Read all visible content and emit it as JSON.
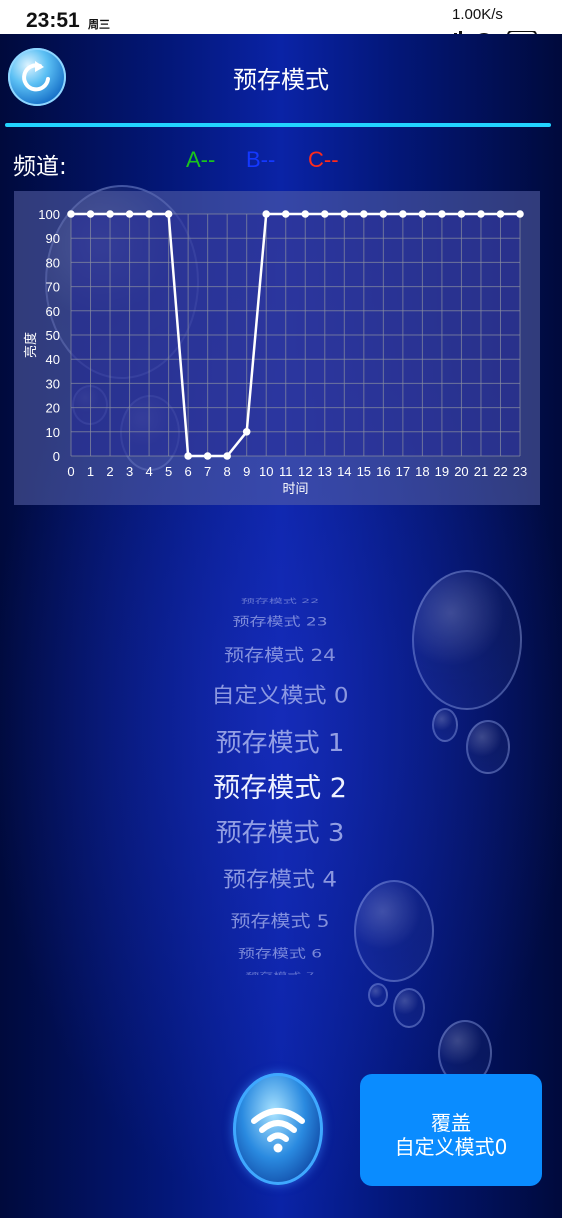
{
  "status_bar": {
    "time": "23:51",
    "weekday": "周三",
    "net_speed": "1.00K/s",
    "battery": "62"
  },
  "header": {
    "title": "预存模式"
  },
  "channel": {
    "label": "频道:",
    "a": "A--",
    "b": "B--",
    "c": "C--",
    "colors": {
      "a": "#19c41c",
      "b": "#1438ff",
      "c": "#ff2a1a"
    }
  },
  "chart_data": {
    "type": "line",
    "x": [
      0,
      1,
      2,
      3,
      4,
      5,
      6,
      7,
      8,
      9,
      10,
      11,
      12,
      13,
      14,
      15,
      16,
      17,
      18,
      19,
      20,
      21,
      22,
      23
    ],
    "series": [
      {
        "values": [
          100,
          100,
          100,
          100,
          100,
          100,
          0,
          0,
          0,
          10,
          100,
          100,
          100,
          100,
          100,
          100,
          100,
          100,
          100,
          100,
          100,
          100,
          100,
          100
        ]
      }
    ],
    "xlabel": "时间",
    "ylabel": "亮度",
    "ylim": [
      0,
      100
    ],
    "yticks": [
      0,
      10,
      20,
      30,
      40,
      50,
      60,
      70,
      80,
      90,
      100
    ],
    "grid": true,
    "line_color": "#ffffff"
  },
  "picker": {
    "items": [
      "预存模式 22",
      "预存模式 23",
      "预存模式 24",
      "自定义模式 0",
      "预存模式 1",
      "预存模式 2",
      "预存模式 3",
      "预存模式 4",
      "预存模式 5",
      "预存模式 6",
      "预存模式 7"
    ],
    "selected_index": 5
  },
  "override_button": {
    "line1": "覆盖",
    "line2": "自定义模式0"
  }
}
